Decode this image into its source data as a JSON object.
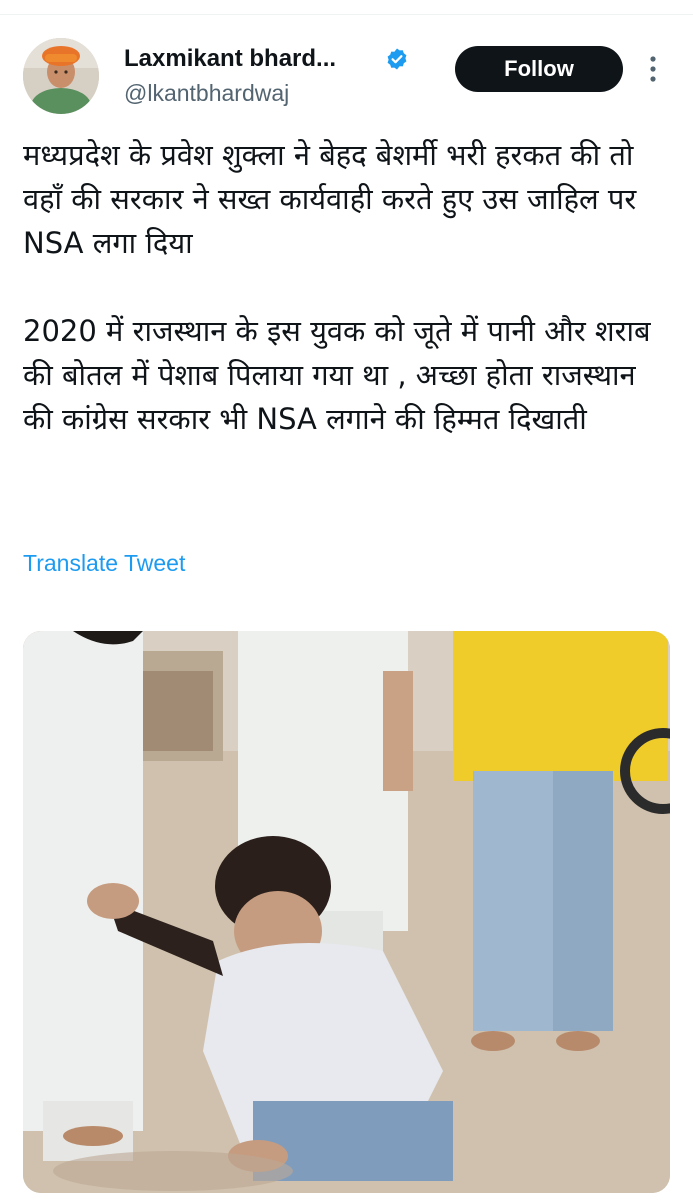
{
  "header": {
    "display_name": "Laxmikant bhard...",
    "handle": "@lkantbhardwaj",
    "follow_label": "Follow"
  },
  "tweet": {
    "paragraphs": [
      "मध्यप्रदेश के प्रवेश शुक्ला ने बेहद बेशर्मी भरी हरकत की तो वहाँ की सरकार ने सख्त कार्यवाही करते हुए उस जाहिल पर NSA लगा दिया",
      "2020 में राजस्थान के इस युवक को जूते में पानी और शराब की बोतल में पेशाब पिलाया गया था , अच्छा होता राजस्थान की कांग्रेस सरकार भी NSA लगाने की हिम्मत दिखाती"
    ],
    "translate_label": "Translate Tweet"
  },
  "icons": {
    "verified": "verified-badge-icon",
    "more": "more-options-icon"
  },
  "colors": {
    "text_primary": "#0f1419",
    "text_secondary": "#536471",
    "link": "#1d9bf0",
    "verified": "#1d9bf0",
    "follow_button": "#0f1419"
  }
}
